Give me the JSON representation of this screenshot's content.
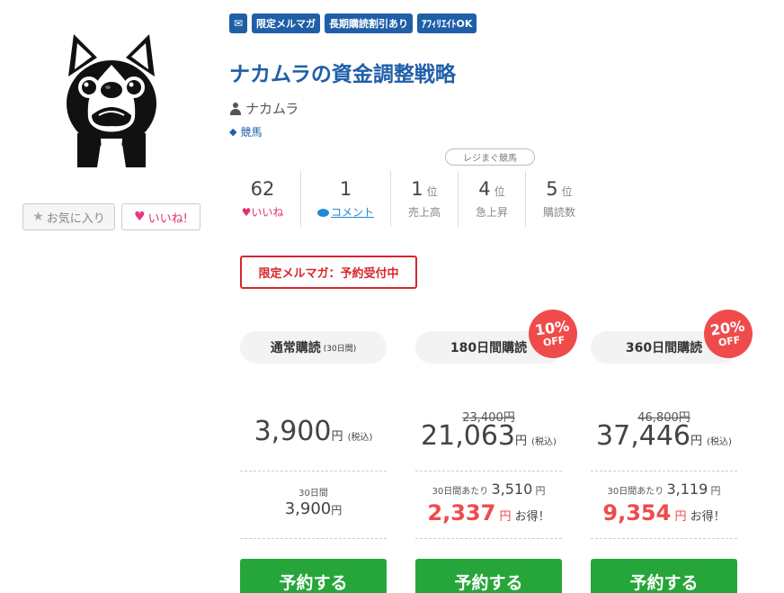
{
  "avatar": {
    "icon": "french-bulldog"
  },
  "actions": {
    "favorite_label": "お気に入り",
    "like_label": "いいね!"
  },
  "badges": [
    {
      "icon": "mail-icon"
    },
    {
      "label": "限定メルマガ"
    },
    {
      "label": "長期購読割引あり"
    },
    {
      "label": "ｱﾌｨﾘｴｲﾄOK"
    }
  ],
  "title": "ナカムラの資金調整戦略",
  "author": "ナカムラ",
  "category": "競馬",
  "ranking_label": "レジまぐ競馬",
  "stats": {
    "likes": {
      "value": "62",
      "label": "いいね"
    },
    "comments": {
      "value": "1",
      "label": "コメント"
    },
    "sales": {
      "value": "1",
      "unit": "位",
      "label": "売上高"
    },
    "rising": {
      "value": "4",
      "unit": "位",
      "label": "急上昇"
    },
    "subscribers": {
      "value": "5",
      "unit": "位",
      "label": "購読数"
    }
  },
  "notice": "限定メルマガ：予約受付中",
  "plans": [
    {
      "name": "通常購読",
      "period_note": "(30日間)",
      "price": "3,900",
      "yen": "円",
      "tax": "(税込)",
      "per_label": "30日間",
      "per_price": "3,900",
      "button": "予約する"
    },
    {
      "name": "180日間購読",
      "discount_pct": "10%",
      "discount_off": "OFF",
      "original_price": "23,400円",
      "price": "21,063",
      "yen": "円",
      "tax": "(税込)",
      "per_label": "30日間あたり",
      "per_price": "3,510",
      "saving": "2,337",
      "saving_suffix": "お得！",
      "button": "予約する"
    },
    {
      "name": "360日間購読",
      "discount_pct": "20%",
      "discount_off": "OFF",
      "original_price": "46,800円",
      "price": "37,446",
      "yen": "円",
      "tax": "(税込)",
      "per_label": "30日間あたり",
      "per_price": "3,119",
      "saving": "9,354",
      "saving_suffix": "お得！",
      "button": "予約する"
    }
  ],
  "colors": {
    "accent_blue": "#1f5fa8",
    "buy_green": "#26a63a",
    "sale_red": "#ef4b4b",
    "notice_red": "#d8262c",
    "like_pink": "#e83a82"
  }
}
